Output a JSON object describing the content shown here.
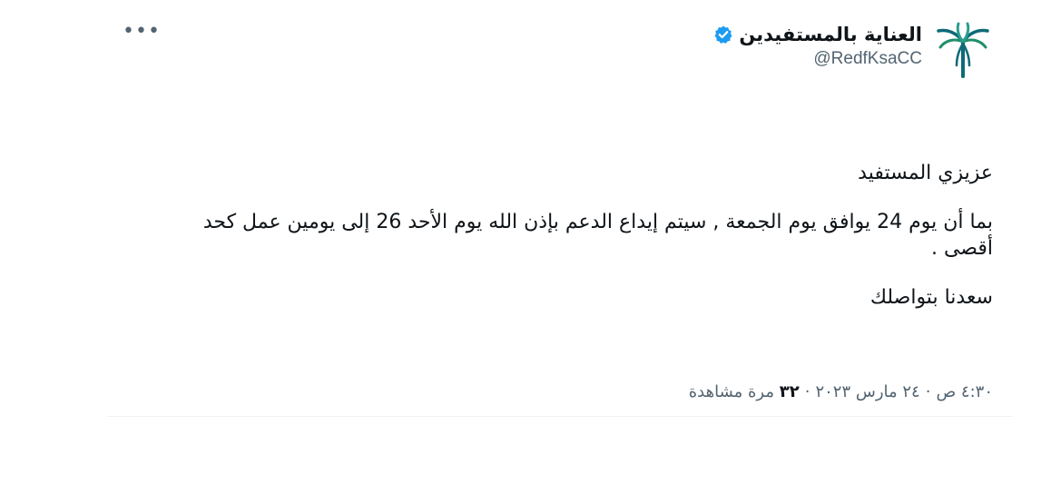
{
  "author": {
    "display_name": "العناية بالمستفيدين",
    "handle": "@RedfKsaCC",
    "avatar_icon": "palm-tree-logo-icon",
    "verified_icon": "verified-badge-icon"
  },
  "colors": {
    "verified": "#1d9bf0",
    "logo_teal": "#0e6a78",
    "logo_green": "#1f8f6a",
    "secondary_text": "#536471"
  },
  "more_icon": "more-options-icon",
  "tweet": {
    "line1": "عزيزي المستفيد",
    "line2": "بما أن يوم 24 يوافق يوم الجمعة , سيتم إيداع الدعم بإذن الله يوم الأحد 26 إلى يومين عمل كحد أقصى .",
    "line3": "سعدنا بتواصلك"
  },
  "meta": {
    "time": "٤:٣٠ ص",
    "date": "٢٤ مارس ٢٠٢٣",
    "views_count": "٣٢",
    "views_label": "مرة مشاهدة"
  }
}
